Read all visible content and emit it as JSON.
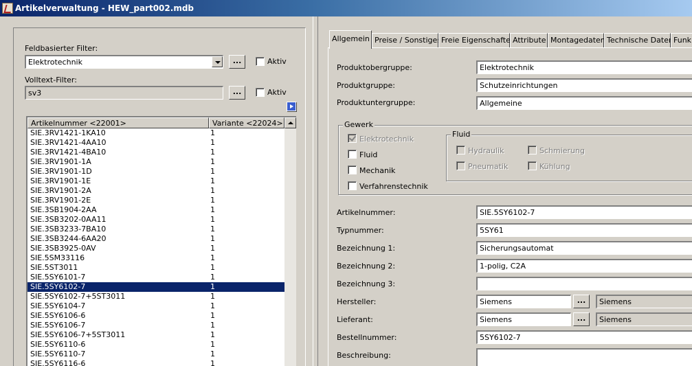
{
  "window": {
    "title": "Artikelverwaltung - HEW_part002.mdb"
  },
  "left": {
    "field_filter_label": "Feldbasierter Filter:",
    "field_filter_value": "Elektrotechnik",
    "text_filter_label": "Volltext-Filter:",
    "text_filter_value": "sv3",
    "ellipsis": "...",
    "active_label": "Aktiv",
    "list": {
      "col1": "Artikelnummer <22001>",
      "col2": "Variante <22024>",
      "rows": [
        {
          "a": "SIE.3RV1421-1KA10",
          "v": "1"
        },
        {
          "a": "SIE.3RV1421-4AA10",
          "v": "1"
        },
        {
          "a": "SIE.3RV1421-4BA10",
          "v": "1"
        },
        {
          "a": "SIE.3RV1901-1A",
          "v": "1"
        },
        {
          "a": "SIE.3RV1901-1D",
          "v": "1"
        },
        {
          "a": "SIE.3RV1901-1E",
          "v": "1"
        },
        {
          "a": "SIE.3RV1901-2A",
          "v": "1"
        },
        {
          "a": "SIE.3RV1901-2E",
          "v": "1"
        },
        {
          "a": "SIE.3SB1904-2AA",
          "v": "1"
        },
        {
          "a": "SIE.3SB3202-0AA11",
          "v": "1"
        },
        {
          "a": "SIE.3SB3233-7BA10",
          "v": "1"
        },
        {
          "a": "SIE.3SB3244-6AA20",
          "v": "1"
        },
        {
          "a": "SIE.3SB3925-0AV",
          "v": "1"
        },
        {
          "a": "SIE.5SM33116",
          "v": "1"
        },
        {
          "a": "SIE.5ST3011",
          "v": "1"
        },
        {
          "a": "SIE.5SY6101-7",
          "v": "1"
        },
        {
          "a": "SIE.5SY6102-7",
          "v": "1"
        },
        {
          "a": "SIE.5SY6102-7+5ST3011",
          "v": "1"
        },
        {
          "a": "SIE.5SY6104-7",
          "v": "1"
        },
        {
          "a": "SIE.5SY6106-6",
          "v": "1"
        },
        {
          "a": "SIE.5SY6106-7",
          "v": "1"
        },
        {
          "a": "SIE.5SY6106-7+5ST3011",
          "v": "1"
        },
        {
          "a": "SIE.5SY6110-6",
          "v": "1"
        },
        {
          "a": "SIE.5SY6110-7",
          "v": "1"
        },
        {
          "a": "SIE.5SY6116-6",
          "v": "1"
        }
      ],
      "selected": "SIE.5SY6102-7"
    }
  },
  "tabs": [
    "Allgemein",
    "Preise / Sonstiges",
    "Freie Eigenschaften",
    "Attribute",
    "Montagedaten",
    "Technische Daten",
    "Funk"
  ],
  "form": {
    "produktobergruppe_label": "Produktobergruppe:",
    "produktobergruppe": "Elektrotechnik",
    "produktgruppe_label": "Produktgruppe:",
    "produktgruppe": "Schutzeinrichtungen",
    "produktuntergruppe_label": "Produktuntergruppe:",
    "produktuntergruppe": "Allgemeine",
    "gewerk_label": "Gewerk",
    "gewerk": {
      "elektrotechnik": "Elektrotechnik",
      "fluid": "Fluid",
      "mechanik": "Mechanik",
      "verfahrenstechnik": "Verfahrenstechnik"
    },
    "fluid_label": "Fluid",
    "fluid": {
      "hydraulik": "Hydraulik",
      "schmierung": "Schmierung",
      "pneumatik": "Pneumatik",
      "kuehlung": "Kühlung"
    },
    "artikelnummer_label": "Artikelnummer:",
    "artikelnummer": "SIE.5SY6102-7",
    "typnummer_label": "Typnummer:",
    "typnummer": "5SY61",
    "bezeichnung1_label": "Bezeichnung 1:",
    "bezeichnung1": "Sicherungsautomat",
    "bezeichnung2_label": "Bezeichnung 2:",
    "bezeichnung2": "1-polig, C2A",
    "bezeichnung3_label": "Bezeichnung 3:",
    "bezeichnung3": "",
    "hersteller_label": "Hersteller:",
    "hersteller": "Siemens",
    "hersteller_name": "Siemens",
    "lieferant_label": "Lieferant:",
    "lieferant": "Siemens",
    "lieferant_name": "Siemens",
    "bestellnummer_label": "Bestellnummer:",
    "bestellnummer": "5SY6102-7",
    "beschreibung_label": "Beschreibung:",
    "beschreibung": ""
  }
}
